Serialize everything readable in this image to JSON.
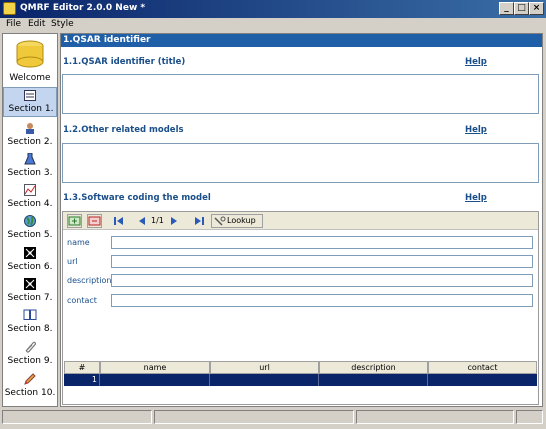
{
  "window": {
    "title": "QMRF Editor 2.0.0 New *",
    "minimize": "_",
    "maximize": "□",
    "close": "×"
  },
  "menu": [
    "File",
    "Edit",
    "Style"
  ],
  "nav": [
    {
      "label": "Welcome",
      "icon": "database-icon"
    },
    {
      "label": "Section 1.",
      "icon": "document-icon"
    },
    {
      "label": "Section 2.",
      "icon": "person-icon"
    },
    {
      "label": "Section 3.",
      "icon": "flask-icon"
    },
    {
      "label": "Section 4.",
      "icon": "chart-icon"
    },
    {
      "label": "Section 5.",
      "icon": "globe-icon"
    },
    {
      "label": "Section 6.",
      "icon": "molecule-icon"
    },
    {
      "label": "Section 7.",
      "icon": "molecule-icon"
    },
    {
      "label": "Section 8.",
      "icon": "book-icon"
    },
    {
      "label": "Section 9.",
      "icon": "paperclip-icon"
    },
    {
      "label": "Section 10.",
      "icon": "pencil-icon"
    }
  ],
  "selected_nav": "Section 1.",
  "header": "1.QSAR identifier",
  "sections": [
    {
      "title": "1.1.QSAR identifier (title)",
      "help": "Help",
      "value": ""
    },
    {
      "title": "1.2.Other related models",
      "help": "Help",
      "value": ""
    },
    {
      "title": "1.3.Software coding the model",
      "help": "Help"
    }
  ],
  "software": {
    "pager": "1/1",
    "lookup": "Lookup",
    "fields": [
      {
        "label": "name",
        "value": ""
      },
      {
        "label": "url",
        "value": ""
      },
      {
        "label": "description",
        "value": ""
      },
      {
        "label": "contact",
        "value": ""
      }
    ],
    "table": {
      "columns": [
        "#",
        "name",
        "url",
        "description",
        "contact"
      ],
      "rows": [
        [
          "1",
          "",
          "",
          "",
          ""
        ]
      ]
    }
  },
  "colors": {
    "header": "#1f5fa8",
    "selection": "#0a246a",
    "link": "#1a4f8a"
  }
}
